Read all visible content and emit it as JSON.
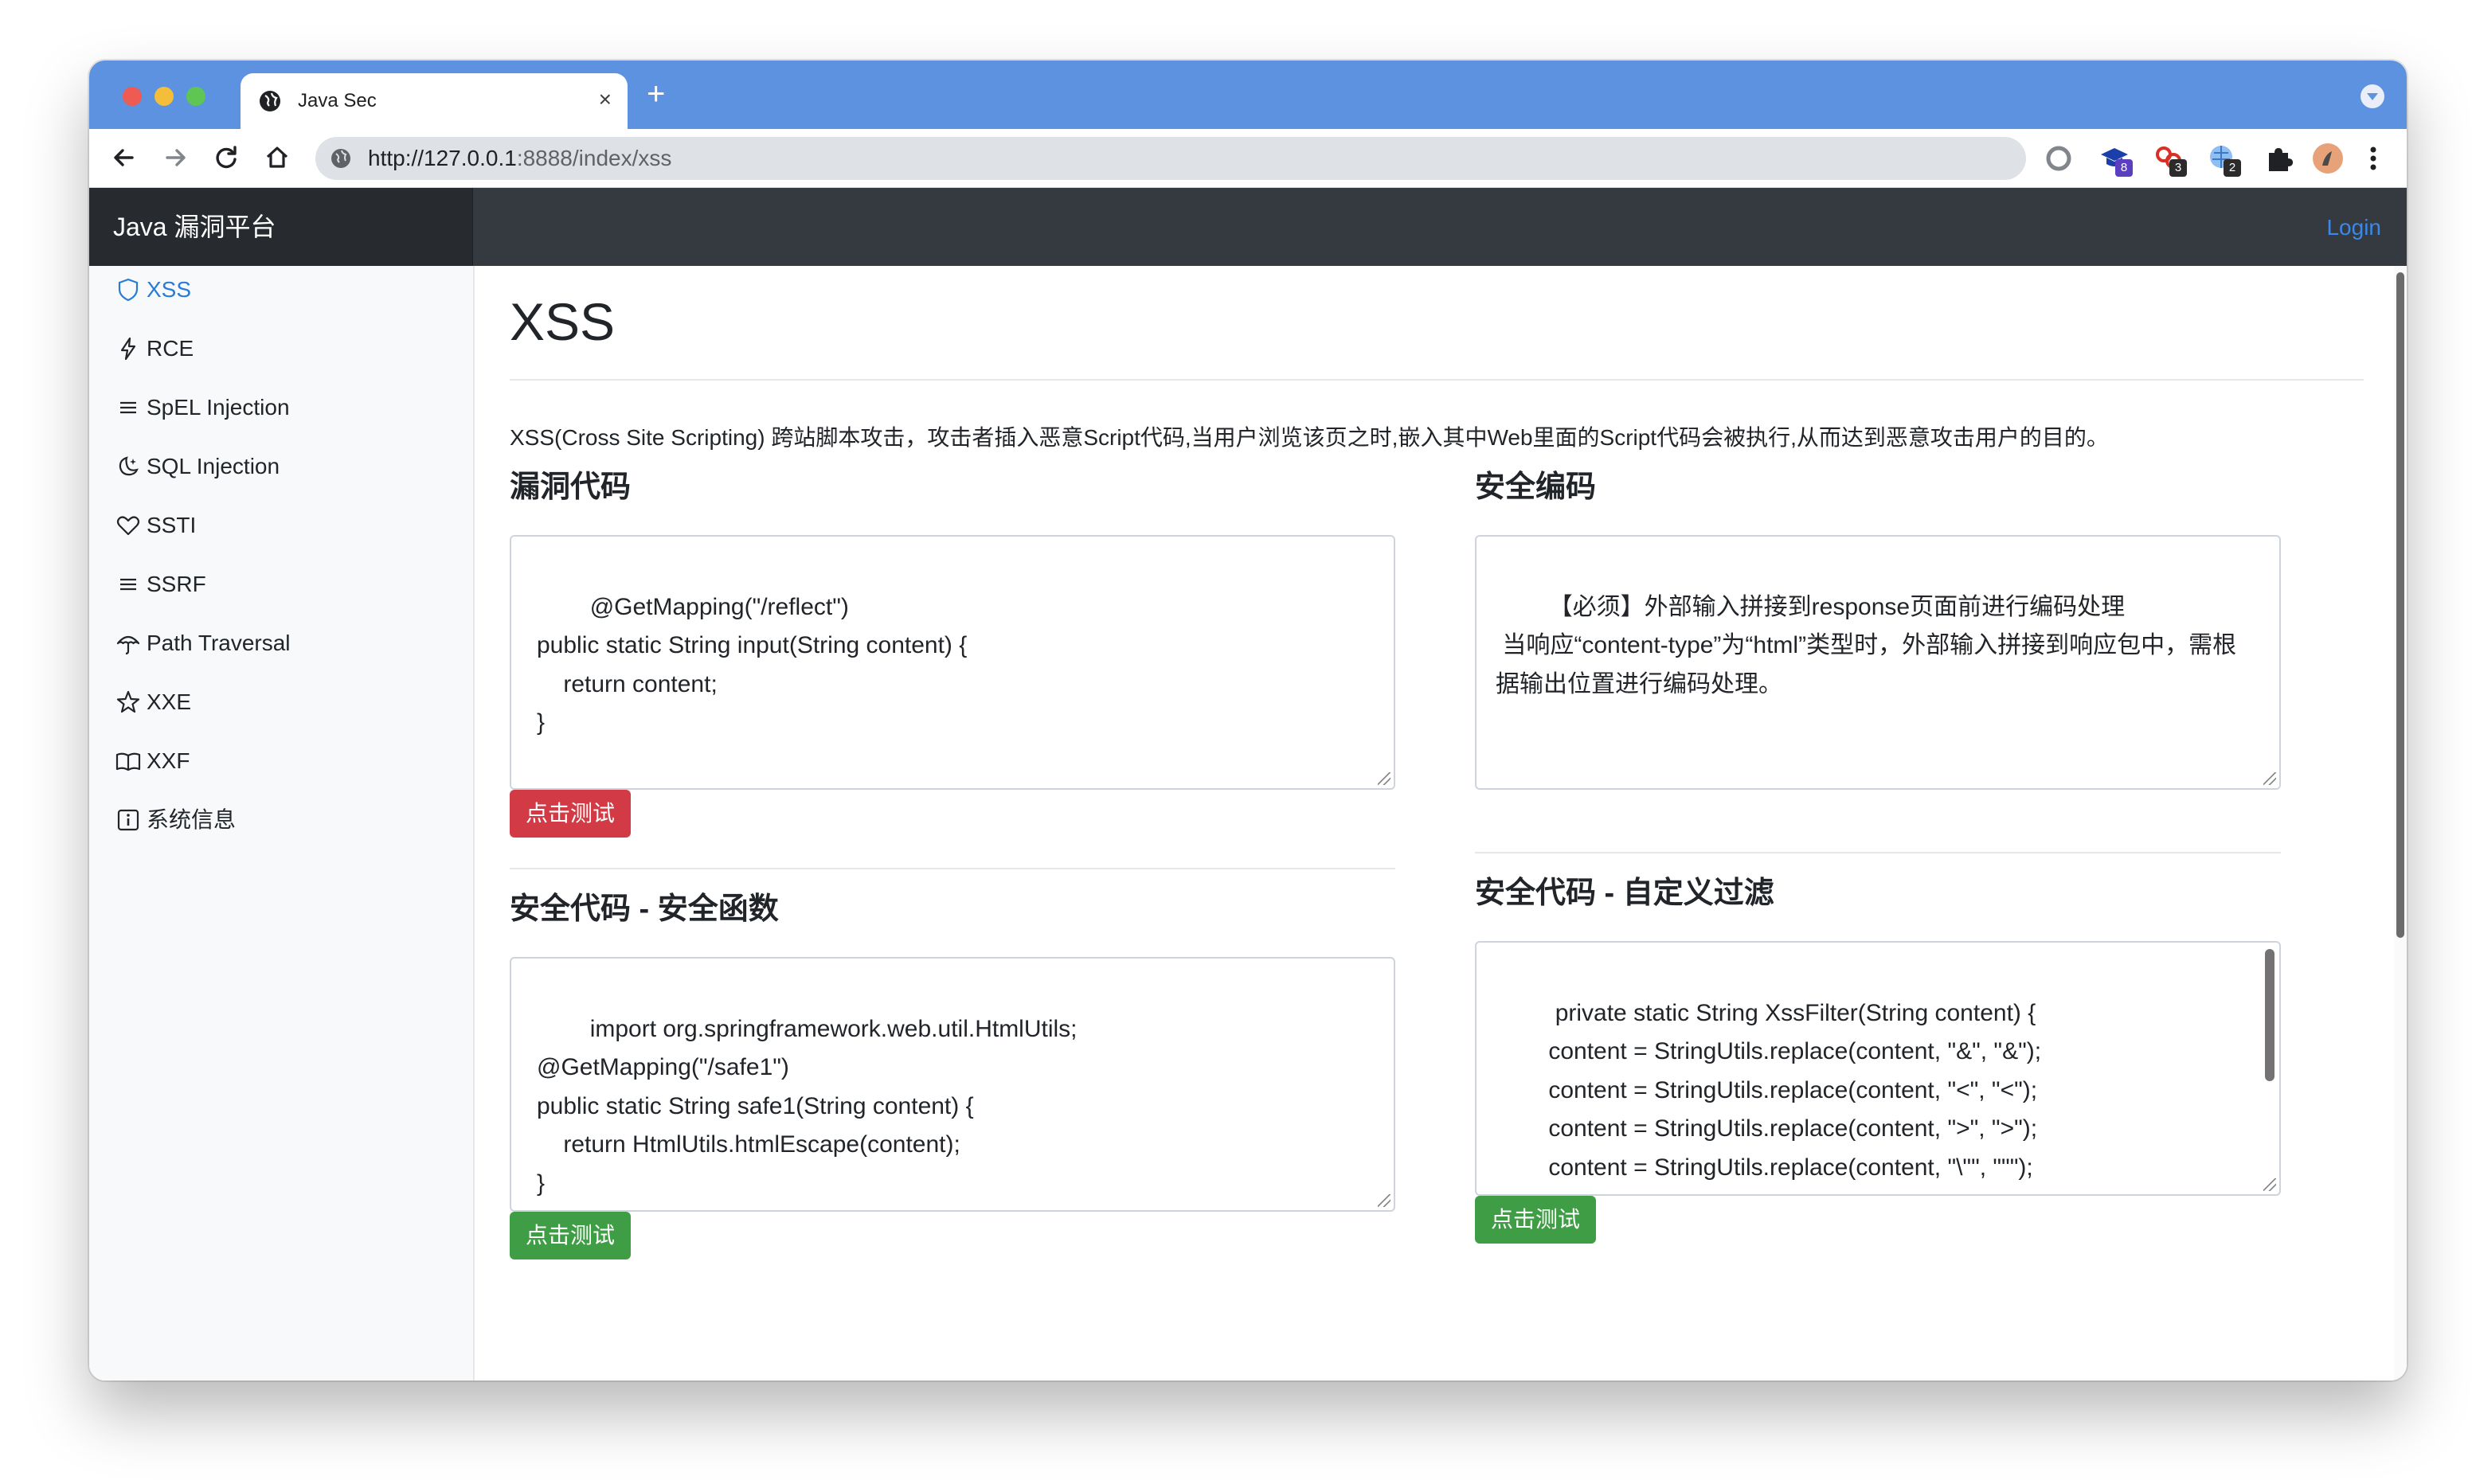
{
  "browser": {
    "tab_title": "Java Sec",
    "url_host": "http://127.0.0.1",
    "url_path": ":8888/index/xss",
    "new_tab_label": "+",
    "close_label": "×",
    "extensions": [
      {
        "name": "circle-extension-icon",
        "badge": ""
      },
      {
        "name": "graduation-cap-extension-icon",
        "badge": "8"
      },
      {
        "name": "red-extension-icon",
        "badge": "3"
      },
      {
        "name": "globe-extension-icon",
        "badge": "2"
      },
      {
        "name": "puzzle-extension-icon",
        "badge": ""
      }
    ]
  },
  "navbar": {
    "brand": "Java 漏洞平台",
    "login": "Login"
  },
  "sidebar": {
    "items": [
      {
        "label": "XSS",
        "icon": "shield-icon",
        "active": true
      },
      {
        "label": "RCE",
        "icon": "lightning-icon"
      },
      {
        "label": "SpEL Injection",
        "icon": "list-icon"
      },
      {
        "label": "SQL Injection",
        "icon": "moon-stars-icon"
      },
      {
        "label": "SSTI",
        "icon": "heart-icon"
      },
      {
        "label": "SSRF",
        "icon": "list-icon"
      },
      {
        "label": "Path Traversal",
        "icon": "umbrella-icon"
      },
      {
        "label": "XXE",
        "icon": "star-icon"
      },
      {
        "label": "XXF",
        "icon": "book-icon"
      },
      {
        "label": "系统信息",
        "icon": "info-icon"
      }
    ]
  },
  "main": {
    "title": "XSS",
    "description": "XSS(Cross Site Scripting) 跨站脚本攻击，攻击者插入恶意Script代码,当用户浏览该页之时,嵌入其中Web里面的Script代码会被执行,从而达到恶意攻击用户的目的。",
    "vuln": {
      "heading": "漏洞代码",
      "code": "@GetMapping(\"/reflect\")\npublic static String input(String content) {\n    return content;\n}",
      "button": "点击测试"
    },
    "encode": {
      "heading": "安全编码",
      "text": "【必须】外部输入拼接到response页面前进行编码处理\n 当响应“content-type”为“html”类型时，外部输入拼接到响应包中，需根据输出位置进行编码处理。"
    },
    "safe_func": {
      "heading": "安全代码 - 安全函数",
      "code": "import org.springframework.web.util.HtmlUtils;\n@GetMapping(\"/safe1\")\npublic static String safe1(String content) {\n    return HtmlUtils.htmlEscape(content);\n}",
      "button": "点击测试"
    },
    "safe_filter": {
      "heading": "安全代码 - 自定义过滤",
      "code": "private static String XssFilter(String content) {\n       content = StringUtils.replace(content, \"&\", \"&\");\n       content = StringUtils.replace(content, \"<\", \"<\");\n       content = StringUtils.replace(content, \">\", \">\");\n       content = StringUtils.replace(content, \"\\\"\", \"\"\");\n       content = StringUtils.replace(content, \"'\", \"'\");",
      "button": "点击测试"
    }
  },
  "colors": {
    "tabstrip": "#5c92e0",
    "navbar": "#343a40",
    "link": "#2a7bd6",
    "danger": "#d23a45",
    "success": "#3f9e45"
  }
}
